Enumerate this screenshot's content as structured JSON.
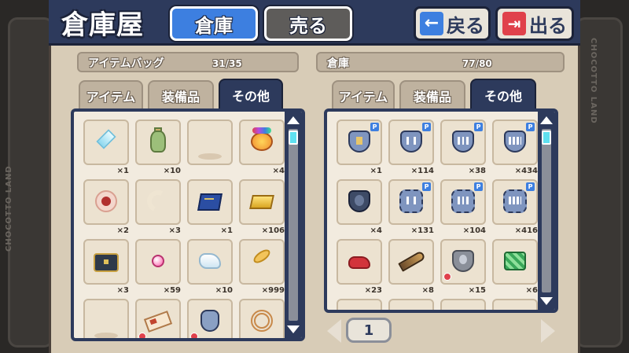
{
  "header": {
    "title": "倉庫屋",
    "tab_storage": "倉庫",
    "tab_sell": "売る",
    "back_label": "戻る",
    "exit_label": "出る"
  },
  "bg": {
    "side_text": "CHOCOTTO LAND"
  },
  "bag": {
    "title": "アイテムバッグ",
    "count": "31/35",
    "tabs": [
      "アイテム",
      "装備品",
      "その他"
    ],
    "active_tab": "その他",
    "slots": [
      {
        "icon": "crystal-icon",
        "qty": "×1"
      },
      {
        "icon": "vase-icon",
        "qty": "×10"
      },
      {
        "icon": "empty-slot-icon",
        "qty": ""
      },
      {
        "icon": "rainbow-orb-icon",
        "qty": "×4"
      },
      {
        "icon": "spider-emblem-icon",
        "qty": "×2"
      },
      {
        "icon": "horn-icon",
        "qty": "×3"
      },
      {
        "icon": "book-icon",
        "qty": "×1"
      },
      {
        "icon": "gold-bar-icon",
        "qty": "×106"
      },
      {
        "icon": "chest-icon",
        "qty": "×3"
      },
      {
        "icon": "pink-orb-icon",
        "qty": "×59"
      },
      {
        "icon": "ice-chunk-icon",
        "qty": "×10"
      },
      {
        "icon": "feather-icon",
        "qty": "×999"
      },
      {
        "icon": "empty-slot-icon",
        "qty": ""
      },
      {
        "icon": "ticket-icon",
        "qty": ""
      },
      {
        "icon": "emblem-icon",
        "qty": ""
      },
      {
        "icon": "coil-icon",
        "qty": ""
      }
    ]
  },
  "storage": {
    "title": "倉庫",
    "count": "77/80",
    "tabs": [
      "アイテム",
      "装備品",
      "その他"
    ],
    "active_tab": "その他",
    "slots": [
      {
        "icon": "emblem-i-icon",
        "qty": "×1"
      },
      {
        "icon": "emblem-ii-icon",
        "qty": "×114"
      },
      {
        "icon": "emblem-iii-icon",
        "qty": "×38"
      },
      {
        "icon": "emblem-iv-icon",
        "qty": "×434"
      },
      {
        "icon": "emblem-dark-icon",
        "qty": "×4"
      },
      {
        "icon": "gear-emblem-ii-icon",
        "qty": "×131"
      },
      {
        "icon": "gear-emblem-iii-icon",
        "qty": "×104"
      },
      {
        "icon": "gear-emblem-iv-icon",
        "qty": "×416"
      },
      {
        "icon": "red-cloth-icon",
        "qty": "×23"
      },
      {
        "icon": "horn-trumpet-icon",
        "qty": "×8"
      },
      {
        "icon": "gray-emblem-icon",
        "qty": "×15"
      },
      {
        "icon": "green-cube-icon",
        "qty": "×6"
      }
    ],
    "page": "1"
  },
  "colors": {
    "navy": "#2d3a5c",
    "blue": "#3d7fe0",
    "red": "#e0414b",
    "panel": "#d8ccb7",
    "slot": "#ece2d0",
    "scroll_thumb": "#5fe0f0"
  }
}
